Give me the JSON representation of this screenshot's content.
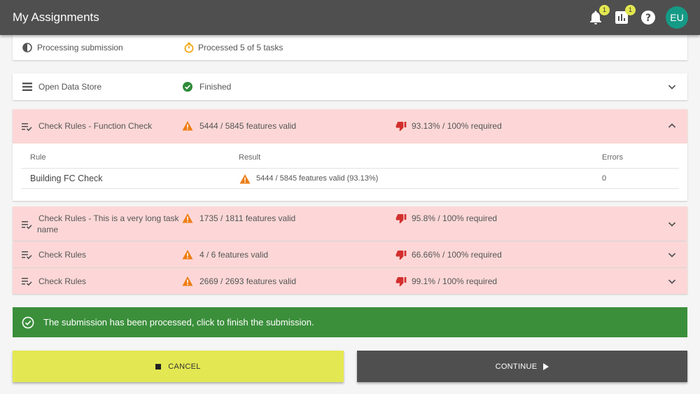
{
  "header": {
    "title": "My Assignments",
    "notifications_badge": "1",
    "reports_badge": "1",
    "avatar_initials": "EU"
  },
  "tasks": [
    {
      "name": "Processing submission",
      "status": "Processed 5 of 5 tasks"
    },
    {
      "name": "Open Data Store",
      "status": "Finished"
    },
    {
      "name": "Check Rules - Function Check",
      "status": "5444 / 5845 features valid",
      "rate": "93.13% / 100% required"
    },
    {
      "name_line1": "Check Rules - This is a very long task",
      "name_line2": "name",
      "status": "1735 / 1811 features valid",
      "rate": "95.8% / 100% required"
    },
    {
      "name": "Check Rules",
      "status": "4 / 6 features valid",
      "rate": "66.66% / 100% required"
    },
    {
      "name": "Check Rules",
      "status": "2669 / 2693 features valid",
      "rate": "99.1% / 100% required"
    }
  ],
  "rules_table": {
    "columns": [
      "Rule",
      "Result",
      "Errors"
    ],
    "rows": [
      {
        "rule": "Building FC Check",
        "result": "5444 / 5845 features valid (93.13%)",
        "errors": "0"
      }
    ]
  },
  "banner": {
    "message": "The submission has been processed, click to finish the submission."
  },
  "actions": {
    "cancel_label": "CANCEL",
    "continue_label": "CONTINUE"
  },
  "colors": {
    "appbar": "#4f4f4f",
    "error_row": "#fdd7d7",
    "warning": "#ef7d14",
    "fail": "#d32f2f",
    "success": "#3b8f3b",
    "accent": "#e3e852",
    "avatar": "#159a86"
  }
}
